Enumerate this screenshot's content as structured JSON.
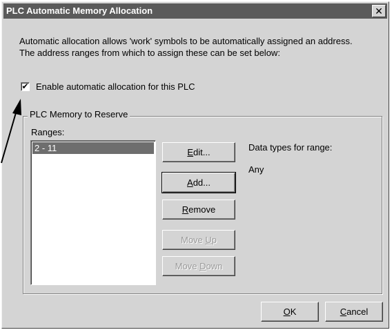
{
  "window": {
    "title": "PLC Automatic Memory Allocation",
    "close_glyph": "✕"
  },
  "intro": {
    "line1": "Automatic allocation allows 'work' symbols to be automatically assigned an address.",
    "line2": "The address ranges from which to assign these can be set below:"
  },
  "enable_checkbox": {
    "label": "Enable automatic allocation for this PLC",
    "checked": true,
    "glyph": "✔"
  },
  "group": {
    "title": "PLC Memory to Reserve",
    "ranges_label": "Ranges:",
    "ranges": [
      "2 - 11"
    ],
    "data_types_label": "Data types for range:",
    "data_types_value": "Any"
  },
  "buttons": {
    "edit": {
      "pre": "",
      "accel": "E",
      "post": "dit..."
    },
    "add": {
      "pre": "",
      "accel": "A",
      "post": "dd..."
    },
    "remove": {
      "pre": "",
      "accel": "R",
      "post": "emove"
    },
    "move_up": {
      "pre": "Move ",
      "accel": "U",
      "post": "p"
    },
    "move_down": {
      "pre": "Move ",
      "accel": "D",
      "post": "own"
    },
    "ok": {
      "pre": "",
      "accel": "O",
      "post": "K"
    },
    "cancel": {
      "pre": "",
      "accel": "C",
      "post": "ancel"
    }
  },
  "colors": {
    "title_bar": "#5a5a5a",
    "face": "#d4d4d4",
    "selection": "#6e6e6e"
  },
  "icons": {
    "annotation": "arrow-pointer-icon",
    "close": "close-icon"
  }
}
